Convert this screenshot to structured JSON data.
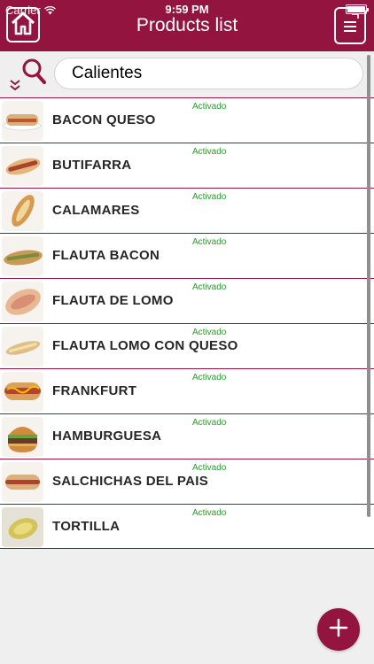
{
  "status_bar": {
    "carrier": "Carrier",
    "time": "9:59 PM"
  },
  "header": {
    "title": "Products list",
    "home_icon": "home-icon",
    "menu_icon": "document-list-icon"
  },
  "search": {
    "value": "Calientes",
    "icon": "search-filter-icon"
  },
  "products": [
    {
      "name": "BACON QUESO",
      "status": "Activado"
    },
    {
      "name": "BUTIFARRA",
      "status": "Activado"
    },
    {
      "name": "CALAMARES",
      "status": "Activado"
    },
    {
      "name": "FLAUTA BACON",
      "status": "Activado"
    },
    {
      "name": "FLAUTA DE LOMO",
      "status": "Activado"
    },
    {
      "name": "FLAUTA LOMO CON QUESO",
      "status": "Activado"
    },
    {
      "name": "FRANKFURT",
      "status": "Activado"
    },
    {
      "name": "HAMBURGUESA",
      "status": "Activado"
    },
    {
      "name": "SALCHICHAS DEL PAIS",
      "status": "Activado"
    },
    {
      "name": "TORTILLA",
      "status": "Activado"
    }
  ],
  "colors": {
    "brand": "#93143f",
    "status_green": "#2a9a2a"
  }
}
